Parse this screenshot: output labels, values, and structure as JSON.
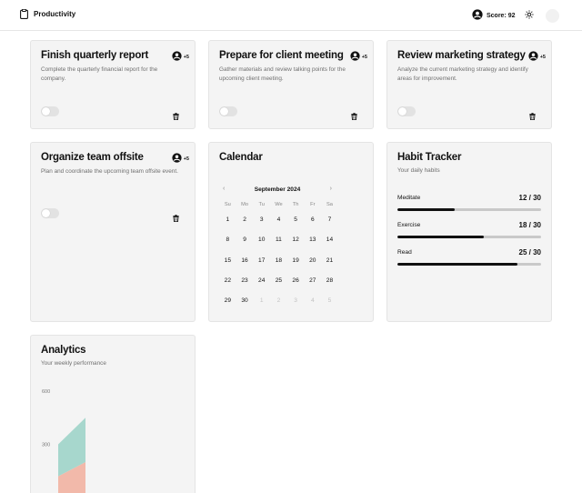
{
  "header": {
    "app_name": "Productivity",
    "score_label": "Score: 92"
  },
  "tasks": [
    {
      "title": "Finish quarterly report",
      "description": "Complete the quarterly financial report for the company.",
      "extra_assignees": "+5",
      "completed": false
    },
    {
      "title": "Prepare for client meeting",
      "description": "Gather materials and review talking points for the upcoming client meeting.",
      "extra_assignees": "+5",
      "completed": false
    },
    {
      "title": "Review marketing strategy",
      "description": "Analyze the current marketing strategy and identify areas for improvement.",
      "extra_assignees": "+5",
      "completed": false
    },
    {
      "title": "Organize team offsite",
      "description": "Plan and coordinate the upcoming team offsite event.",
      "extra_assignees": "+5",
      "completed": false
    }
  ],
  "calendar": {
    "title": "Calendar",
    "month_label": "September 2024",
    "prev_icon": "chevron-left-icon",
    "next_icon": "chevron-right-icon",
    "weekdays": [
      "Su",
      "Mo",
      "Tu",
      "We",
      "Th",
      "Fr",
      "Sa"
    ],
    "days": [
      {
        "d": "1",
        "current": true
      },
      {
        "d": "2",
        "current": true
      },
      {
        "d": "3",
        "current": true
      },
      {
        "d": "4",
        "current": true
      },
      {
        "d": "5",
        "current": true
      },
      {
        "d": "6",
        "current": true
      },
      {
        "d": "7",
        "current": true
      },
      {
        "d": "8",
        "current": true
      },
      {
        "d": "9",
        "current": true
      },
      {
        "d": "10",
        "current": true
      },
      {
        "d": "11",
        "current": true
      },
      {
        "d": "12",
        "current": true
      },
      {
        "d": "13",
        "current": true
      },
      {
        "d": "14",
        "current": true
      },
      {
        "d": "15",
        "current": true
      },
      {
        "d": "16",
        "current": true
      },
      {
        "d": "17",
        "current": true
      },
      {
        "d": "18",
        "current": true
      },
      {
        "d": "19",
        "current": true
      },
      {
        "d": "20",
        "current": true
      },
      {
        "d": "21",
        "current": true
      },
      {
        "d": "22",
        "current": true
      },
      {
        "d": "23",
        "current": true
      },
      {
        "d": "24",
        "current": true
      },
      {
        "d": "25",
        "current": true
      },
      {
        "d": "26",
        "current": true
      },
      {
        "d": "27",
        "current": true
      },
      {
        "d": "28",
        "current": true
      },
      {
        "d": "29",
        "current": true
      },
      {
        "d": "30",
        "current": true
      },
      {
        "d": "1",
        "current": false
      },
      {
        "d": "2",
        "current": false
      },
      {
        "d": "3",
        "current": false
      },
      {
        "d": "4",
        "current": false
      },
      {
        "d": "5",
        "current": false
      }
    ]
  },
  "habits": {
    "title": "Habit Tracker",
    "subtitle": "Your daily habits",
    "items": [
      {
        "name": "Meditate",
        "count_label": "12 / 30",
        "progress": 0.4
      },
      {
        "name": "Exercise",
        "count_label": "18 / 30",
        "progress": 0.6
      },
      {
        "name": "Read",
        "count_label": "25 / 30",
        "progress": 0.8333
      }
    ]
  },
  "analytics": {
    "title": "Analytics",
    "subtitle": "Your weekly performance",
    "chart_data": {
      "type": "area",
      "x": [
        0,
        1
      ],
      "series": [
        {
          "values": [
            120,
            200
          ],
          "color": "#f2b9aa"
        },
        {
          "values": [
            180,
            250
          ],
          "color": "#a7d7cd"
        }
      ],
      "stacked": true,
      "ylim": [
        0,
        600
      ],
      "y_ticks": [
        "600",
        "300"
      ],
      "grid": false
    }
  },
  "colors": {
    "accent": "#111111",
    "card_bg": "#f4f4f4",
    "bar_track": "#c9c9c9"
  }
}
